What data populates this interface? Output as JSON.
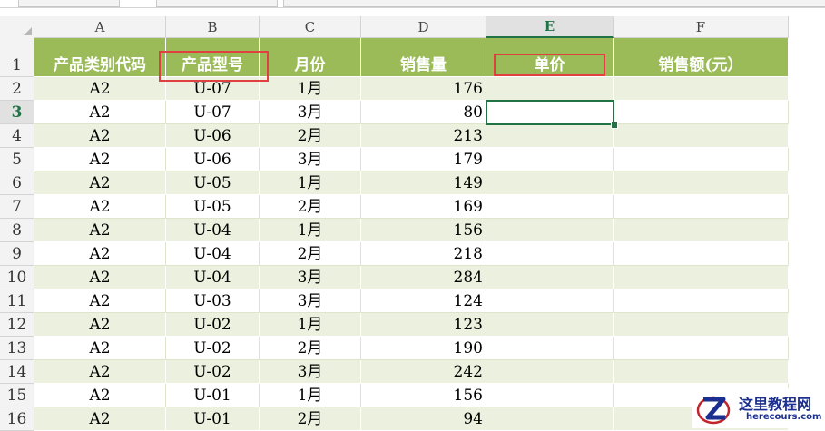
{
  "sheet": {
    "columns": [
      "A",
      "B",
      "C",
      "D",
      "E",
      "F"
    ],
    "active_column": "E",
    "active_row": 3,
    "header_row": {
      "row_number": "1",
      "cells": [
        "产品类别代码",
        "产品型号",
        "月份",
        "销售量",
        "单价",
        "销售额(元）"
      ]
    },
    "rows": [
      {
        "n": "2",
        "a": "A2",
        "b": "U-07",
        "c": "1月",
        "d": "176"
      },
      {
        "n": "3",
        "a": "A2",
        "b": "U-07",
        "c": "3月",
        "d": "80"
      },
      {
        "n": "4",
        "a": "A2",
        "b": "U-06",
        "c": "2月",
        "d": "213"
      },
      {
        "n": "5",
        "a": "A2",
        "b": "U-06",
        "c": "3月",
        "d": "179"
      },
      {
        "n": "6",
        "a": "A2",
        "b": "U-05",
        "c": "1月",
        "d": "149"
      },
      {
        "n": "7",
        "a": "A2",
        "b": "U-05",
        "c": "2月",
        "d": "169"
      },
      {
        "n": "8",
        "a": "A2",
        "b": "U-04",
        "c": "1月",
        "d": "156"
      },
      {
        "n": "9",
        "a": "A2",
        "b": "U-04",
        "c": "2月",
        "d": "218"
      },
      {
        "n": "10",
        "a": "A2",
        "b": "U-04",
        "c": "3月",
        "d": "284"
      },
      {
        "n": "11",
        "a": "A2",
        "b": "U-03",
        "c": "3月",
        "d": "124"
      },
      {
        "n": "12",
        "a": "A2",
        "b": "U-02",
        "c": "1月",
        "d": "123"
      },
      {
        "n": "13",
        "a": "A2",
        "b": "U-02",
        "c": "2月",
        "d": "190"
      },
      {
        "n": "14",
        "a": "A2",
        "b": "U-02",
        "c": "3月",
        "d": "242"
      },
      {
        "n": "15",
        "a": "A2",
        "b": "U-01",
        "c": "1月",
        "d": "156"
      },
      {
        "n": "16",
        "a": "A2",
        "b": "U-01",
        "c": "2月",
        "d": "94"
      }
    ],
    "highlighted_headers": [
      "产品型号",
      "单价"
    ]
  },
  "colors": {
    "header_fill": "#9bbb59",
    "band_fill": "#ebf1de",
    "selection": "#217346",
    "annotation": "#e04040"
  },
  "watermark": {
    "icon": "z-logo-icon",
    "title": "这里教程网",
    "subtitle": "herecours.com"
  }
}
